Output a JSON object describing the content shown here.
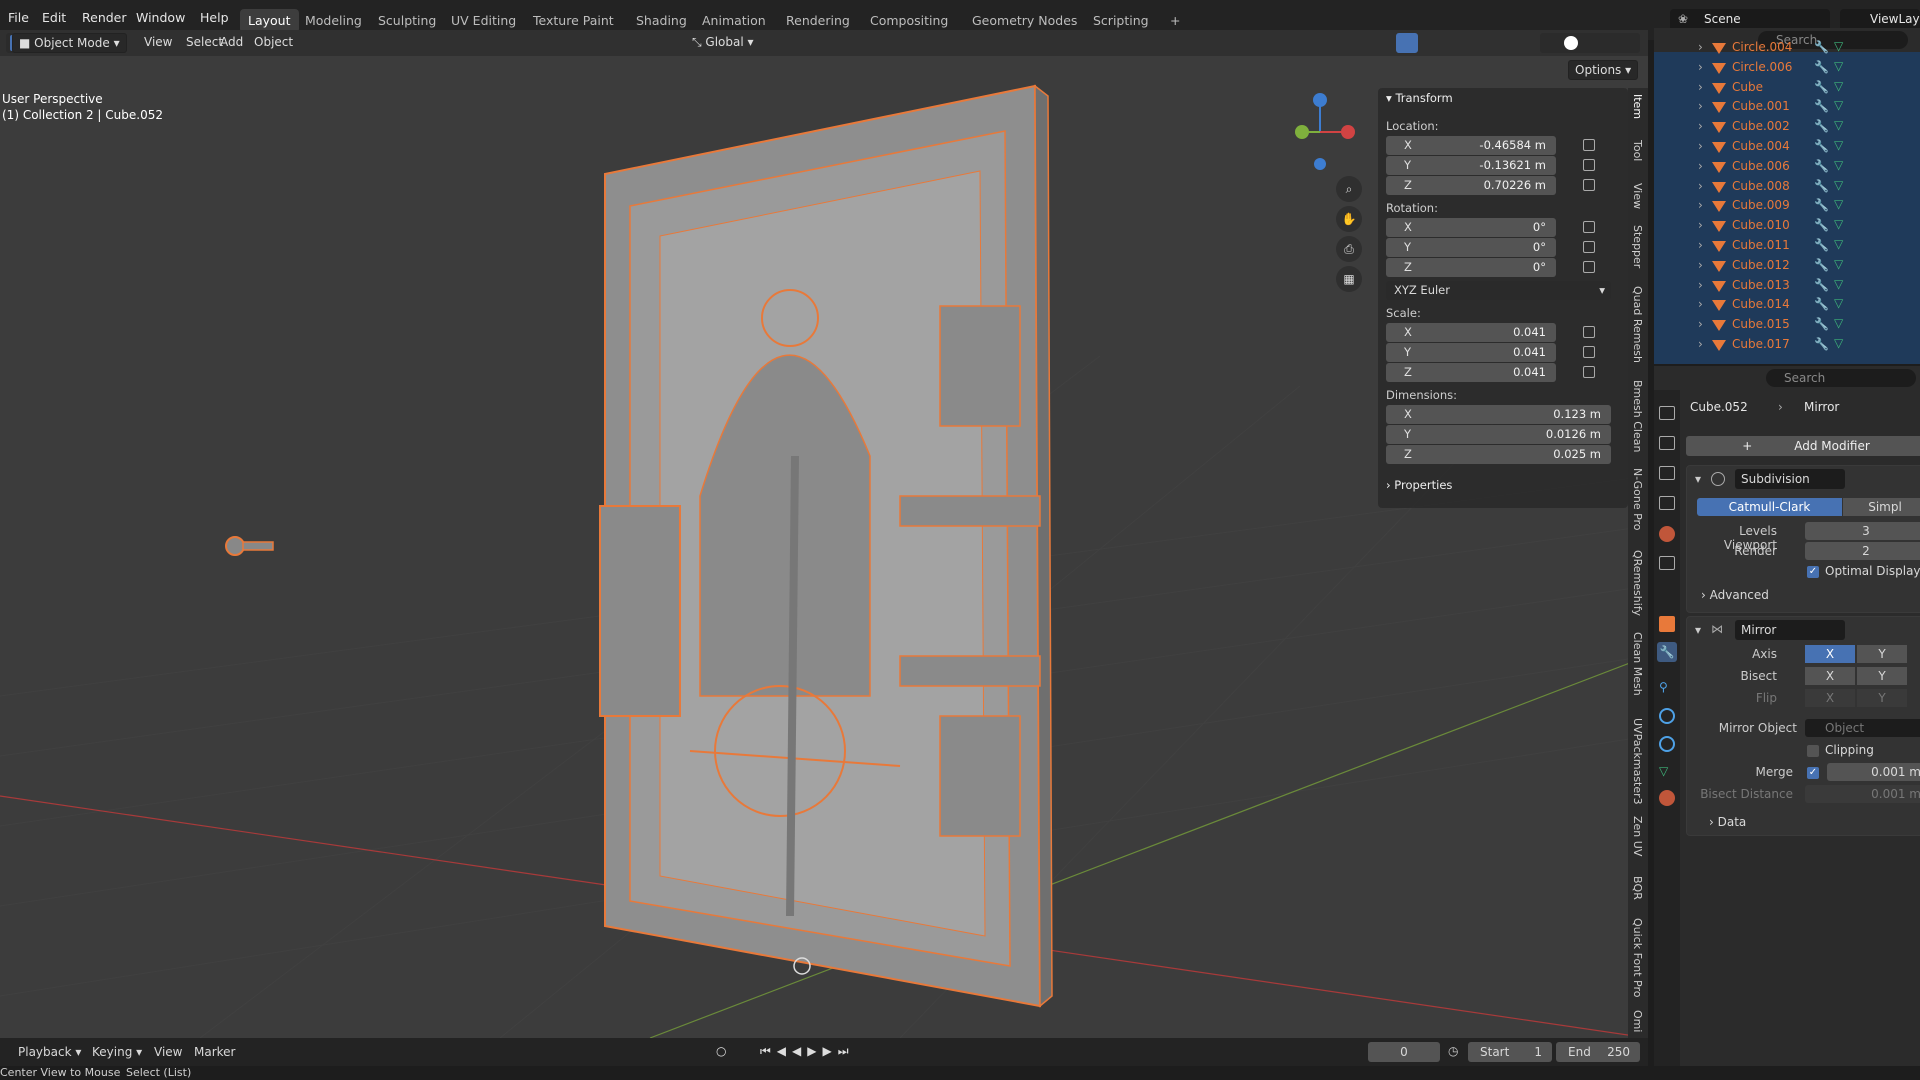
{
  "menu": [
    "File",
    "Edit",
    "Render",
    "Window",
    "Help"
  ],
  "workspaces": [
    "Layout",
    "Modeling",
    "Sculpting",
    "UV Editing",
    "Texture Paint",
    "Shading",
    "Animation",
    "Rendering",
    "Compositing",
    "Geometry Nodes",
    "Scripting",
    "+"
  ],
  "scene": {
    "label": "Scene",
    "viewlayer": "ViewLay"
  },
  "viewport_header": {
    "mode": "Object Mode",
    "view": "View",
    "select": "Select",
    "add": "Add",
    "object": "Object",
    "transform": "Global",
    "options": "Options"
  },
  "overlay_text": {
    "perspective": "User Perspective",
    "collection": "(1) Collection 2 | Cube.052"
  },
  "npanel": {
    "transform_title": "Transform",
    "location_label": "Location:",
    "location": [
      {
        "axis": "X",
        "value": "-0.46584 m"
      },
      {
        "axis": "Y",
        "value": "-0.13621 m"
      },
      {
        "axis": "Z",
        "value": "0.70226 m"
      }
    ],
    "rotation_label": "Rotation:",
    "rotation": [
      {
        "axis": "X",
        "value": "0°"
      },
      {
        "axis": "Y",
        "value": "0°"
      },
      {
        "axis": "Z",
        "value": "0°"
      }
    ],
    "rotation_mode": "XYZ Euler",
    "scale_label": "Scale:",
    "scale": [
      {
        "axis": "X",
        "value": "0.041"
      },
      {
        "axis": "Y",
        "value": "0.041"
      },
      {
        "axis": "Z",
        "value": "0.041"
      }
    ],
    "dimensions_label": "Dimensions:",
    "dimensions": [
      {
        "axis": "X",
        "value": "0.123 m"
      },
      {
        "axis": "Y",
        "value": "0.0126 m"
      },
      {
        "axis": "Z",
        "value": "0.025 m"
      }
    ],
    "properties_title": "Properties"
  },
  "side_tabs": [
    "Item",
    "Tool",
    "View",
    "Stepper",
    "Quad Remesh",
    "Bmesh Clean",
    "N-Gone Pro",
    "QRemeshify",
    "Clean Mesh",
    "UVPackmaster3",
    "Zen UV",
    "BQR",
    "Quick Font Pro",
    "Omi"
  ],
  "outliner": {
    "search_placeholder": "Search",
    "items": [
      "Circle.004",
      "Circle.006",
      "Cube",
      "Cube.001",
      "Cube.002",
      "Cube.004",
      "Cube.006",
      "Cube.008",
      "Cube.009",
      "Cube.010",
      "Cube.011",
      "Cube.012",
      "Cube.013",
      "Cube.014",
      "Cube.015",
      "Cube.017"
    ]
  },
  "properties": {
    "search_placeholder": "Search",
    "object": "Cube.052",
    "modifier_crumb": "Mirror",
    "add_modifier": "Add Modifier",
    "subdivision": {
      "name": "Subdivision",
      "catmull": "Catmull-Clark",
      "simple": "Simpl",
      "levels_label": "Levels Viewport",
      "levels": "3",
      "render_label": "Render",
      "render": "2",
      "optimal": "Optimal Display",
      "advanced": "Advanced"
    },
    "mirror": {
      "name": "Mirror",
      "axis_label": "Axis",
      "bisect_label": "Bisect",
      "flip_label": "Flip",
      "x": "X",
      "y": "Y",
      "mirror_obj_label": "Mirror Object",
      "mirror_obj_placeholder": "Object",
      "clipping": "Clipping",
      "merge_label": "Merge",
      "merge": "0.001 m",
      "bisect_dist_label": "Bisect Distance",
      "bisect_dist": "0.001 m",
      "data": "Data"
    }
  },
  "timeline": {
    "playback": "Playback",
    "keying": "Keying",
    "view": "View",
    "marker": "Marker",
    "frame": "0",
    "start_label": "Start",
    "start": "1",
    "end_label": "End",
    "end": "250"
  },
  "status": {
    "left": "Center View to Mouse",
    "right": "Select (List)"
  },
  "colors": {
    "accent": "#4772b3",
    "selection": "#e8793a",
    "viewport_bg": "#3c3c3c",
    "outliner_bg": "#1f3a5a"
  }
}
